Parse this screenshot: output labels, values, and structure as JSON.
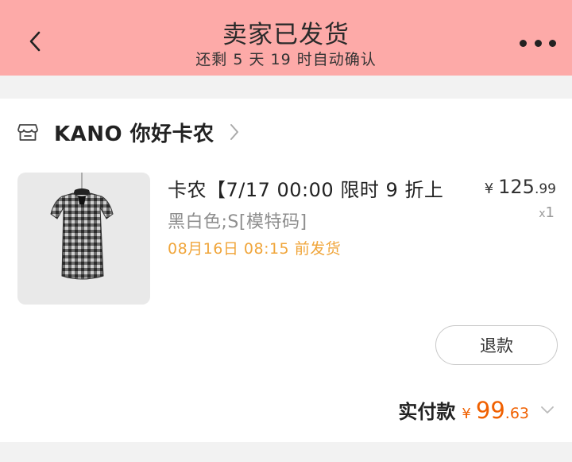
{
  "header": {
    "title": "卖家已发货",
    "subtitle": "还剩 5 天 19 时自动确认",
    "background": "#fdaaa8"
  },
  "shop": {
    "name": "KANO 你好卡农"
  },
  "product": {
    "title": "卡农【7/17 00:00 限时 9 折上",
    "spec": "黑白色;S[模特码]",
    "ship_time": "08月16日 08:15 前发货",
    "currency": "¥",
    "price_int": "125",
    "price_dec": ".99",
    "qty_prefix": "x",
    "qty": "1"
  },
  "actions": {
    "refund_label": "退款"
  },
  "total": {
    "label": "实付款",
    "currency": "¥",
    "amount_int": "99",
    "amount_dec": ".63",
    "color": "#f06000"
  },
  "icons": {
    "back": "chevron-left-icon",
    "more": "more-dots-icon",
    "shop": "store-icon",
    "shop_link": "chevron-right-icon",
    "total_expand": "chevron-down-icon"
  }
}
